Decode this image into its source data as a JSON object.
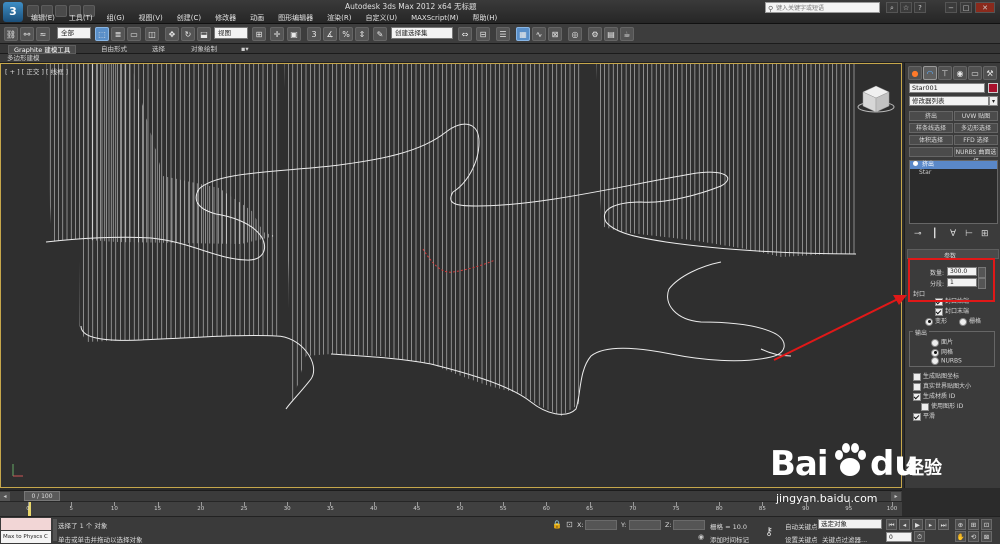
{
  "window": {
    "app_title": "Autodesk 3ds Max  2012 x64      无标题",
    "app_icon": "3ds-max-logo-icon",
    "search_placeholder": "键入关键字或短语",
    "menus": [
      "编辑(E)",
      "工具(T)",
      "组(G)",
      "视图(V)",
      "创建(C)",
      "修改器",
      "动画",
      "图形编辑器",
      "渲染(R)",
      "自定义(U)",
      "MAXScript(M)",
      "帮助(H)"
    ]
  },
  "toolbar": {
    "selection_filter": "全部",
    "reference_coord": "视图",
    "named_selection": "创建选择集"
  },
  "ribbon": {
    "tabs": [
      "Graphite 建模工具",
      "自由形式",
      "选择",
      "对象绘制"
    ],
    "sub_label": "多边形建模"
  },
  "viewport": {
    "label": "[ + ] [ 正交 ] [ 线框 ]"
  },
  "command_panel": {
    "object_name": "Star001",
    "object_color": "#a8102c",
    "modifier_list": "修改器列表",
    "modifier_buttons": [
      "挤出",
      "UVW 贴图",
      "样条线选择",
      "多边形选择",
      "体积选择",
      "FFD 选择",
      "",
      "NURBS 曲面选择"
    ],
    "stack": [
      "挤出",
      "Star"
    ],
    "rollout_params": "参数",
    "amount_label": "数量:",
    "amount_value": "300.0",
    "segments_label": "分段:",
    "segments_value": "1",
    "capping_label": "封口",
    "cap_start": "封口始端",
    "cap_end": "封口末端",
    "morph": "变形",
    "grid": "栅格",
    "output_label": "输出",
    "out_patch": "面片",
    "out_mesh": "网格",
    "out_nurbs": "NURBS",
    "gen_mapping": "生成贴图坐标",
    "real_world": "真实世界贴图大小",
    "gen_mat_ids": "生成材质 ID",
    "use_shape_ids": "使用图形 ID",
    "smooth": "平滑"
  },
  "timeline": {
    "frame_counter": "0 / 100",
    "ticks": [
      "0",
      "5",
      "10",
      "15",
      "20",
      "25",
      "30",
      "35",
      "40",
      "45",
      "50",
      "55",
      "60",
      "65",
      "70",
      "75",
      "80",
      "85",
      "90",
      "95",
      "100"
    ]
  },
  "status": {
    "maxscript_label": "Max to Physcs C",
    "selected": "选择了 1 个 对象",
    "prompt": "单击或单击并拖动以选择对象",
    "x_label": "X:",
    "y_label": "Y:",
    "z_label": "Z:",
    "grid_label": "栅格 = 10.0",
    "add_time_tag": "添加时间标记",
    "auto_key": "自动关键点",
    "set_key": "设置关键点",
    "key_filter": "选定对象",
    "key_filters_btn": "关键点过滤器...",
    "frame_value": "0"
  },
  "watermark": {
    "brand": "Bai",
    "brand2": "du",
    "cn": "经验",
    "url": "jingyan.baidu.com"
  }
}
